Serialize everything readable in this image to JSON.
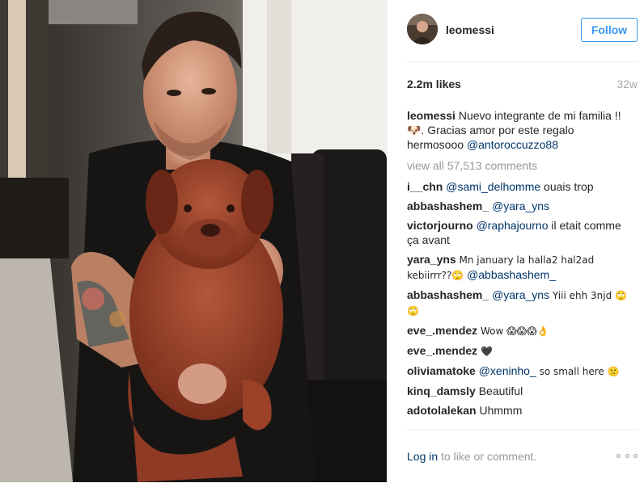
{
  "header": {
    "username": "leomessi",
    "follow_label": "Follow"
  },
  "stats": {
    "likes": "2.2m likes",
    "age": "32w"
  },
  "caption": {
    "user": "leomessi",
    "text": " Nuevo integrante de mi familia !!🐶. Gracias amor por este regalo hermosooo ",
    "mention": "@antoroccuzzo88"
  },
  "view_all": "view all 57,513 comments",
  "comments": [
    {
      "user": "i__chn",
      "mention": "@sami_delhomme",
      "text": " ouais trop"
    },
    {
      "user": "abbashashem_",
      "mention": "@yara_yns",
      "text": ""
    },
    {
      "user": "victorjourno",
      "mention": "@raphajourno",
      "text": " il etait comme ça avant"
    },
    {
      "user": "yara_yns",
      "mention": "",
      "text": " Mn january la halla2 hal2ad kebiirrr??🙄 ",
      "mention2": "@abbashashem_"
    },
    {
      "user": "abbashashem_",
      "mention": "@yara_yns",
      "text": " Yiii ehh 3njd 🙄🙄"
    },
    {
      "user": "eve_.mendez",
      "mention": "",
      "text": " Wow 😱😱😱👌"
    },
    {
      "user": "eve_.mendez",
      "mention": "",
      "text": " 🖤"
    },
    {
      "user": "oliviamatoke",
      "mention": "@xeninho_",
      "text": " so small here 🙁"
    },
    {
      "user": "kinq_damsly",
      "mention": "",
      "text": " Beautiful"
    },
    {
      "user": "adotolalekan",
      "mention": "",
      "text": " Uhmmm"
    }
  ],
  "footer": {
    "login_link": "Log in",
    "login_text": " to like or comment."
  },
  "icons": {
    "more": "more-options-icon"
  },
  "colors": {
    "accent": "#3897f0",
    "link": "#003569",
    "muted": "#999999",
    "divider": "#efefef"
  }
}
